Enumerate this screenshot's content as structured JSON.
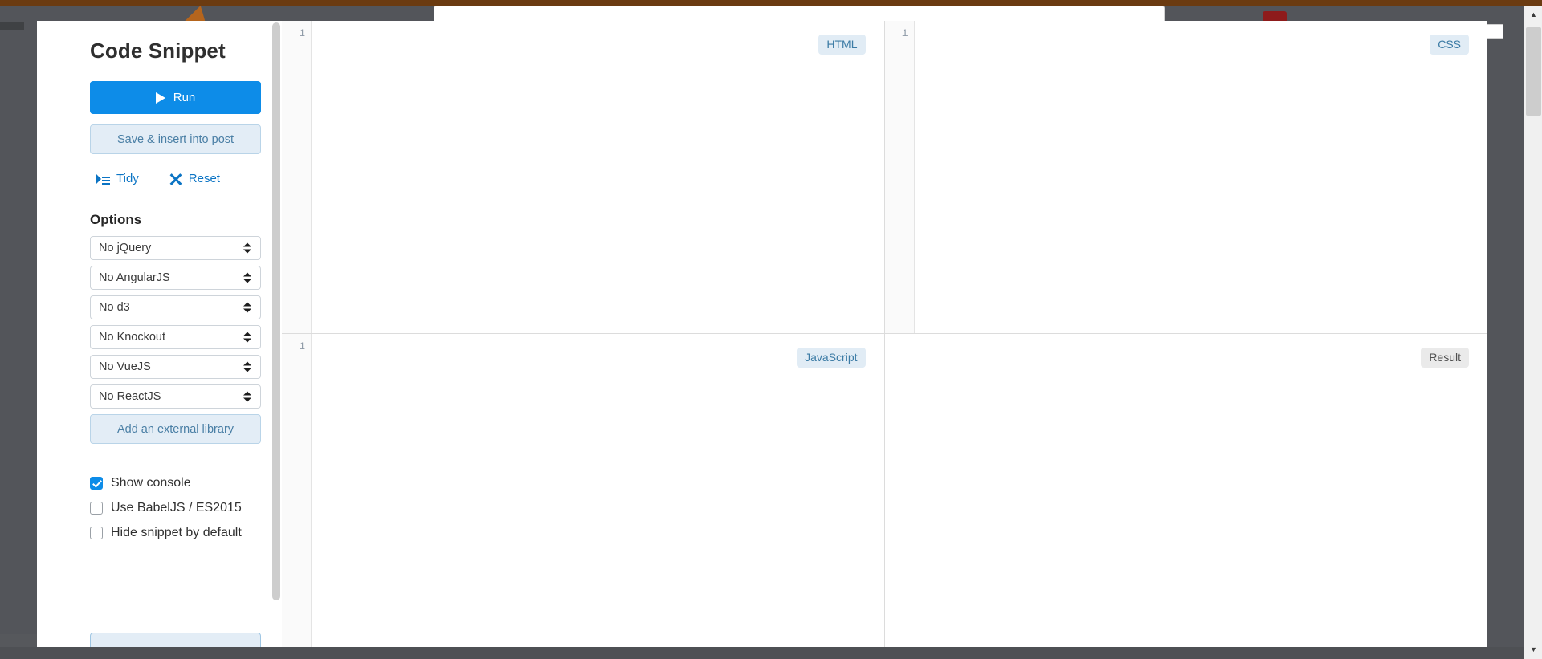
{
  "modal": {
    "title": "Code Snippet",
    "run_button": {
      "label": "Run",
      "icon": "play-icon",
      "color": "#0d8ce8"
    },
    "save_button": {
      "label": "Save & insert into post",
      "color": "#e3edf6"
    },
    "links": [
      {
        "label": "Tidy",
        "icon": "indent-icon"
      },
      {
        "label": "Reset",
        "icon": "close-x-icon"
      }
    ],
    "options": {
      "heading": "Options",
      "selects": [
        {
          "name": "jquery",
          "value": "No jQuery"
        },
        {
          "name": "angularjs",
          "value": "No AngularJS"
        },
        {
          "name": "d3",
          "value": "No d3"
        },
        {
          "name": "knockout",
          "value": "No Knockout"
        },
        {
          "name": "vuejs",
          "value": "No VueJS"
        },
        {
          "name": "reactjs",
          "value": "No ReactJS"
        }
      ],
      "add_library_button": "Add an external library"
    },
    "checkboxes": [
      {
        "label": "Show console",
        "checked": true
      },
      {
        "label": "Use BabelJS / ES2015",
        "checked": false
      },
      {
        "label": "Hide snippet by default",
        "checked": false
      }
    ]
  },
  "editors": [
    {
      "badge": "HTML",
      "line_number": "1",
      "style": "accent"
    },
    {
      "badge": "CSS",
      "line_number": "1",
      "style": "accent"
    },
    {
      "badge": "JavaScript",
      "line_number": "1",
      "style": "accent"
    },
    {
      "badge": "Result",
      "line_number": "",
      "style": "neutral"
    }
  ],
  "colors": {
    "accent": "#0d8ce8",
    "badge_bg": "#e1ecf5",
    "badge_text": "#3b7ba5",
    "backdrop": "#53555a",
    "topbar": "#6b3b11"
  }
}
